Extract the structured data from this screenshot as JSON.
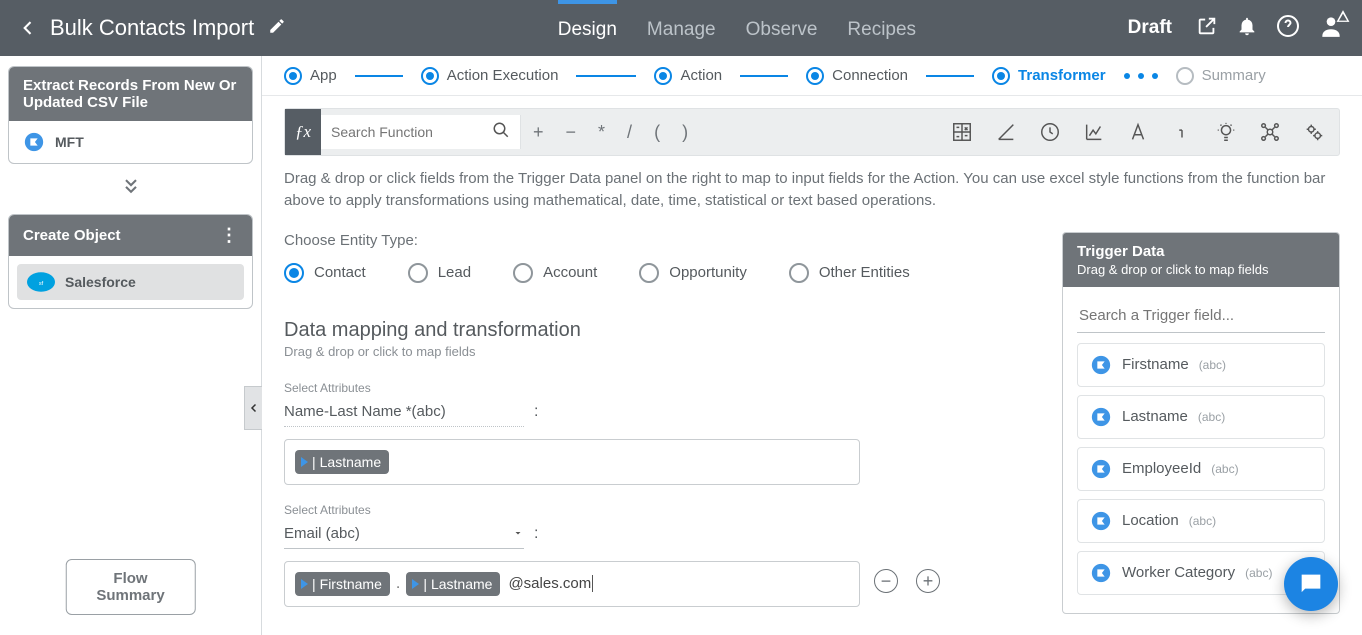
{
  "header": {
    "title": "Bulk Contacts Import",
    "tabs": [
      "Design",
      "Manage",
      "Observe",
      "Recipes"
    ],
    "active_tab": 0,
    "status": "Draft"
  },
  "sidebar": {
    "card1_title": "Extract Records From New Or Updated CSV File",
    "card1_app": "MFT",
    "card2_title": "Create Object",
    "card2_app": "Salesforce",
    "flow_summary_btn": "Flow Summary"
  },
  "stepper": {
    "steps": [
      "App",
      "Action Execution",
      "Action",
      "Connection",
      "Transformer",
      "Summary"
    ],
    "active_index": 4
  },
  "toolbar": {
    "search_placeholder": "Search Function",
    "ops": [
      "+",
      "−",
      "*",
      "/",
      "(",
      ")"
    ]
  },
  "help_text": "Drag & drop or click fields from the Trigger Data panel on the right to map to input fields for the Action. You can use excel style functions from the function bar above to apply transformations using mathematical, date, time, statistical or text based operations.",
  "entity": {
    "label": "Choose Entity Type:",
    "options": [
      "Contact",
      "Lead",
      "Account",
      "Opportunity",
      "Other Entities"
    ],
    "selected": 0
  },
  "mapping": {
    "title": "Data mapping and transformation",
    "subtitle": "Drag & drop or click to map fields",
    "attr_label": "Select Attributes",
    "rows": [
      {
        "select_label": "Name-Last Name *(abc)",
        "chips": [
          "Lastname"
        ],
        "suffix": ""
      },
      {
        "select_label": "Email (abc)",
        "chips": [
          "Firstname",
          "Lastname"
        ],
        "separator": ".",
        "suffix": "@sales.com"
      }
    ]
  },
  "trigger": {
    "title": "Trigger Data",
    "subtitle": "Drag & drop or click to map fields",
    "search_placeholder": "Search a Trigger field...",
    "fields": [
      {
        "name": "Firstname",
        "type": "(abc)"
      },
      {
        "name": "Lastname",
        "type": "(abc)"
      },
      {
        "name": "EmployeeId",
        "type": "(abc)"
      },
      {
        "name": "Location",
        "type": "(abc)"
      },
      {
        "name": "Worker Category",
        "type": "(abc)"
      }
    ]
  }
}
